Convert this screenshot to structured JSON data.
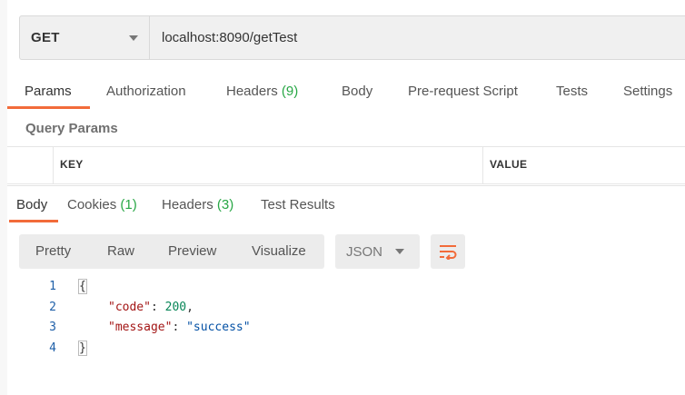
{
  "request": {
    "method": "GET",
    "url": "localhost:8090/getTest"
  },
  "request_tabs": [
    {
      "label": "Params",
      "count": ""
    },
    {
      "label": "Authorization",
      "count": ""
    },
    {
      "label": "Headers",
      "count": "(9)"
    },
    {
      "label": "Body",
      "count": ""
    },
    {
      "label": "Pre-request Script",
      "count": ""
    },
    {
      "label": "Tests",
      "count": ""
    },
    {
      "label": "Settings",
      "count": ""
    }
  ],
  "query_params": {
    "title": "Query Params",
    "columns": [
      "KEY",
      "VALUE"
    ]
  },
  "response_tabs": [
    {
      "label": "Body",
      "count": ""
    },
    {
      "label": "Cookies",
      "count": "(1)"
    },
    {
      "label": "Headers",
      "count": "(3)"
    },
    {
      "label": "Test Results",
      "count": ""
    }
  ],
  "response_toolbar": {
    "views": [
      "Pretty",
      "Raw",
      "Preview",
      "Visualize"
    ],
    "format": "JSON",
    "wrap_icon": "wrap-lines-icon"
  },
  "code": {
    "line_numbers": [
      "1",
      "2",
      "3",
      "4"
    ],
    "open_brace": "{",
    "close_brace": "}",
    "entries": [
      {
        "key": "\"code\"",
        "sep": ": ",
        "value": "200",
        "end": ","
      },
      {
        "key": "\"message\"",
        "sep": ": ",
        "value": "\"success\"",
        "end": ""
      }
    ]
  },
  "colors": {
    "accent": "#f26b3a",
    "count_green": "#28a745"
  }
}
